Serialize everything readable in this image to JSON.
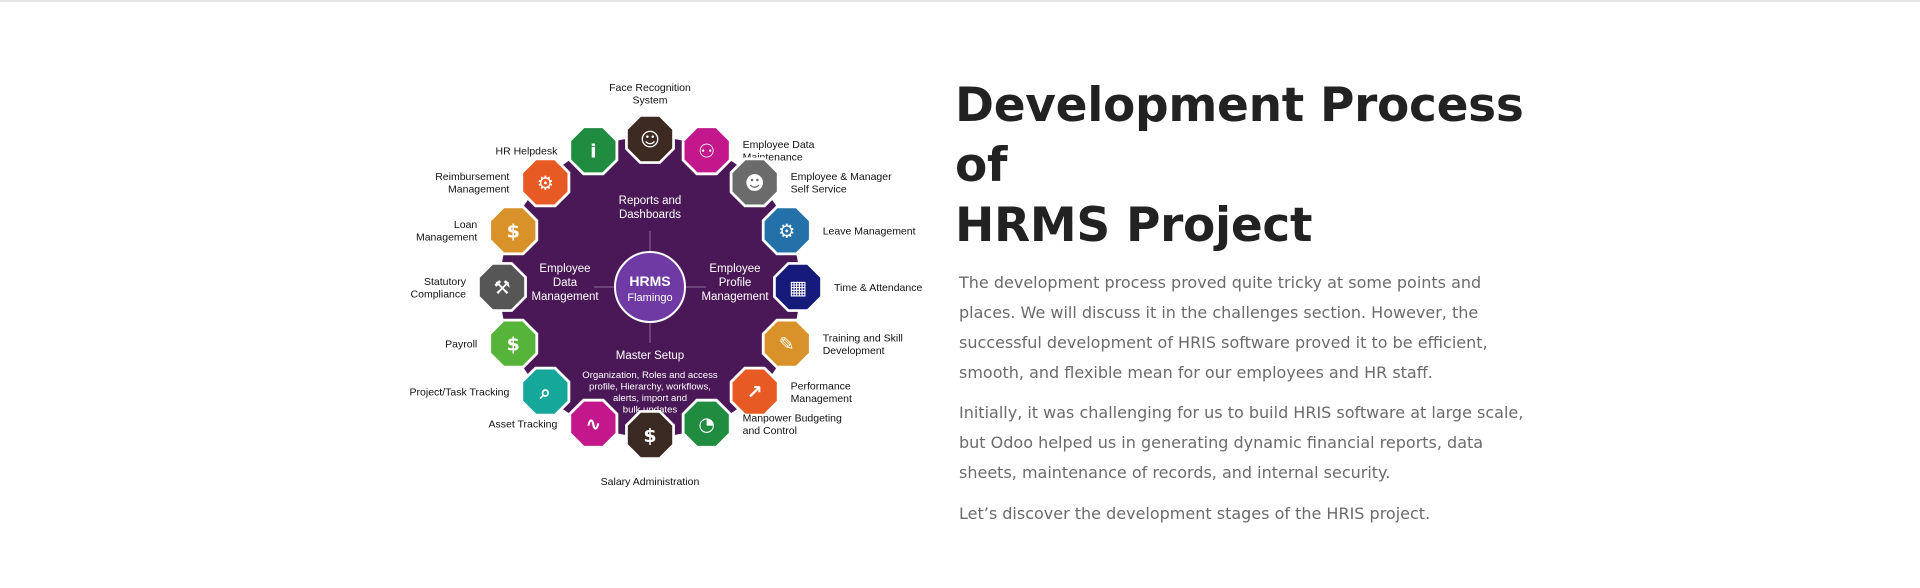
{
  "diagram": {
    "hub": {
      "title": "HRMS",
      "subtitle": "Flamingo",
      "color": "#6f3aa3"
    },
    "wheel_color": "#4a1856",
    "quadrants": {
      "top": [
        "Reports and",
        "Dashboards"
      ],
      "left": [
        "Employee",
        "Data",
        "Management"
      ],
      "right": [
        "Employee",
        "Profile",
        "Management"
      ],
      "bottom_title": "Master Setup",
      "bottom_detail": [
        "Organization, Roles and access",
        "profile, Hierarchy, workflows,",
        "alerts, import and",
        "bulk updates"
      ]
    },
    "modules": [
      {
        "lines": [
          "Face Recognition",
          "System"
        ],
        "color": "#3d2a22",
        "icon": "face-icon"
      },
      {
        "lines": [
          "Employee Data",
          "Maintenance"
        ],
        "color": "#c2188b",
        "icon": "group-icon"
      },
      {
        "lines": [
          "Employee & Manager",
          "Self Service"
        ],
        "color": "#6b6b6b",
        "icon": "users-icon"
      },
      {
        "lines": [
          "Leave Management"
        ],
        "color": "#2470a8",
        "icon": "gear-icon"
      },
      {
        "lines": [
          "Time & Attendance"
        ],
        "color": "#161a7a",
        "icon": "calendar-icon"
      },
      {
        "lines": [
          "Training and Skill",
          "Development"
        ],
        "color": "#d9922a",
        "icon": "document-edit-icon"
      },
      {
        "lines": [
          "Performance",
          "Management"
        ],
        "color": "#e85a23",
        "icon": "bar-chart-icon"
      },
      {
        "lines": [
          "Manpower Budgeting",
          "and Control"
        ],
        "color": "#1f8c3f",
        "icon": "gauge-icon"
      },
      {
        "lines": [
          "Salary Administration"
        ],
        "color": "#3b2a23",
        "icon": "coins-icon"
      },
      {
        "lines": [
          "Asset Tracking"
        ],
        "color": "#c2188b",
        "icon": "line-graph-icon"
      },
      {
        "lines": [
          "Project/Task Tracking"
        ],
        "color": "#14a79a",
        "icon": "magnifier-icon"
      },
      {
        "lines": [
          "Payroll"
        ],
        "color": "#57b43a",
        "icon": "money-hand-icon"
      },
      {
        "lines": [
          "Statutory",
          "Compliance"
        ],
        "color": "#565656",
        "icon": "gavel-icon"
      },
      {
        "lines": [
          "Loan",
          "Management"
        ],
        "color": "#d9922a",
        "icon": "money-bag-icon"
      },
      {
        "lines": [
          "Reimbursement",
          "Management"
        ],
        "color": "#e85a23",
        "icon": "gears-icon"
      },
      {
        "lines": [
          "HR Helpdesk"
        ],
        "color": "#1f8c3f",
        "icon": "info-icon"
      }
    ]
  },
  "content": {
    "heading": [
      "Development Process of",
      "HRMS Project"
    ],
    "paragraphs": [
      "The development process proved quite tricky at some points and places. We will discuss it in the challenges section. However, the successful development of HRIS software proved it to be efficient, smooth, and flexible mean for our employees and HR staff.",
      "Initially, it was challenging for us to build HRIS software at large scale, but Odoo helped us in generating dynamic financial reports, data sheets, maintenance of records, and internal security.",
      "Let’s discover the development stages of the HRIS project."
    ]
  }
}
